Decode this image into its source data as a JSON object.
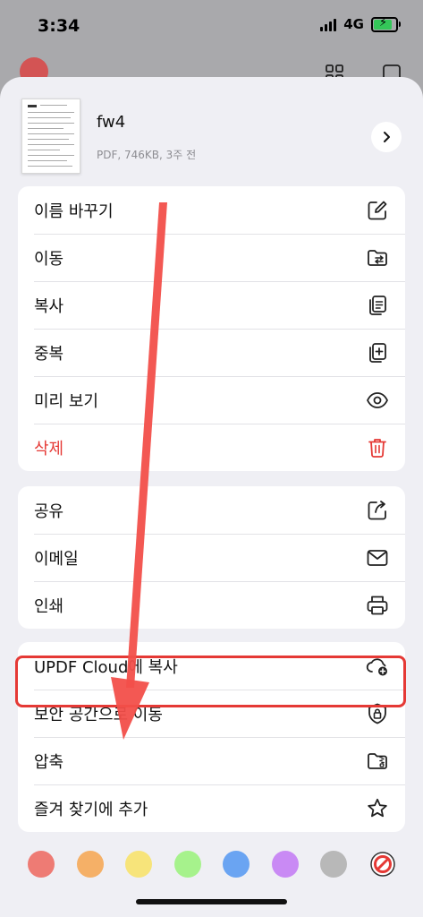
{
  "status": {
    "time": "3:34",
    "network": "4G"
  },
  "file": {
    "name": "fw4",
    "meta": "PDF, 746KB, 3주 전"
  },
  "groups": [
    {
      "items": [
        {
          "label": "이름 바꾸기",
          "icon": "rename-icon"
        },
        {
          "label": "이동",
          "icon": "move-folder-icon"
        },
        {
          "label": "복사",
          "icon": "copy-icon"
        },
        {
          "label": "중복",
          "icon": "duplicate-icon"
        },
        {
          "label": "미리 보기",
          "icon": "eye-icon"
        },
        {
          "label": "삭제",
          "icon": "trash-icon"
        }
      ]
    },
    {
      "items": [
        {
          "label": "공유",
          "icon": "share-icon"
        },
        {
          "label": "이메일",
          "icon": "mail-icon"
        },
        {
          "label": "인쇄",
          "icon": "printer-icon"
        }
      ]
    },
    {
      "items": [
        {
          "label": "UPDF Cloud에 복사",
          "icon": "cloud-add-icon"
        },
        {
          "label": "보안 공간으로 이동",
          "icon": "shield-lock-icon"
        },
        {
          "label": "압축",
          "icon": "zip-folder-icon"
        },
        {
          "label": "즐겨 찾기에 추가",
          "icon": "star-icon"
        }
      ]
    }
  ],
  "colors": {
    "danger": "#e53935",
    "swatches": [
      "#ee7b74",
      "#f5b067",
      "#f7e47a",
      "#a6f28c",
      "#6aa4f2",
      "#c98af4",
      "#b8b8b8"
    ],
    "no_color_icon": "no-color-icon"
  }
}
